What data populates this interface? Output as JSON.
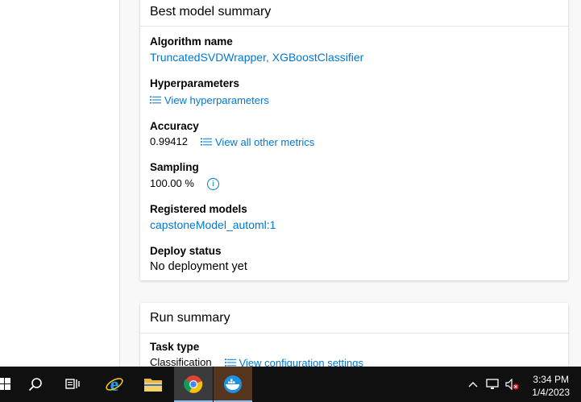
{
  "best_model": {
    "title": "Best model summary",
    "algorithm_label": "Algorithm name",
    "algorithm_value": "TruncatedSVDWrapper, XGBoostClassifier",
    "hyperparameters_label": "Hyperparameters",
    "hyperparameters_link": "View hyperparameters",
    "accuracy_label": "Accuracy",
    "accuracy_value": "0.99412",
    "metrics_link": "View all other metrics",
    "sampling_label": "Sampling",
    "sampling_value": "100.00 %",
    "info_glyph": "i",
    "registered_label": "Registered models",
    "registered_value": "capstoneModel_automl:1",
    "deploy_label": "Deploy status",
    "deploy_value": "No deployment yet"
  },
  "run_summary": {
    "title": "Run summary",
    "task_type_label": "Task type",
    "task_type_value": "Classification",
    "config_link": "View configuration settings"
  },
  "taskbar": {
    "time": "3:34 PM",
    "date": "1/4/2023",
    "icons": [
      "windows-start-icon",
      "search-icon",
      "task-view-icon",
      "internet-explorer-icon",
      "file-explorer-icon",
      "chrome-icon",
      "docker-icon"
    ]
  },
  "colors": {
    "link": "#0078d4",
    "taskbar": "#101010"
  }
}
